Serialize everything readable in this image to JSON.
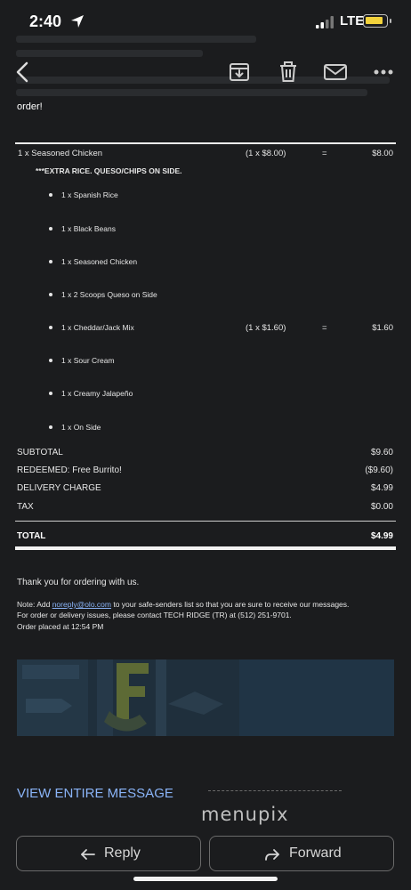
{
  "status_bar": {
    "time": "2:40",
    "carrier": "LTE"
  },
  "email": {
    "order_tail": "order!"
  },
  "order": {
    "main_item": {
      "name": "1 x Seasoned Chicken",
      "qty_price": "(1 x $8.00)",
      "eq": "=",
      "price": "$8.00"
    },
    "note": "***EXTRA RICE. QUESO/CHIPS ON SIDE.",
    "options": [
      {
        "text": "1 x Spanish Rice"
      },
      {
        "text": "1 x Black Beans"
      },
      {
        "text": "1 x Seasoned Chicken"
      },
      {
        "text": "1 x 2 Scoops Queso on Side"
      },
      {
        "text": "1 x Cheddar/Jack Mix",
        "qty_price": "(1 x $1.60)",
        "eq": "=",
        "price": "$1.60"
      },
      {
        "text": "1 x Sour Cream"
      },
      {
        "text": "1 x Creamy Jalapeño"
      },
      {
        "text": "1 x On Side"
      }
    ],
    "summary": [
      {
        "label": "SUBTOTAL",
        "value": "$9.60"
      },
      {
        "label": "REDEEMED: Free Burrito!",
        "value": "($9.60)"
      },
      {
        "label": "DELIVERY CHARGE",
        "value": "$4.99"
      },
      {
        "label": "TAX",
        "value": "$0.00"
      }
    ],
    "total": {
      "label": "TOTAL",
      "value": "$4.99"
    }
  },
  "footer": {
    "thanks": "Thank you for ordering with us.",
    "note_prefix": "Note: Add ",
    "note_link": "noreply@olo.com",
    "note_suffix": " to your safe-senders list so that you are sure to receive our messages.",
    "issues": "For order or delivery issues, please contact TECH RIDGE (TR) at (512) 251-9701.",
    "placed": "Order placed at 12:54 PM"
  },
  "view_entire": "VIEW ENTIRE MESSAGE",
  "watermark": "menupix",
  "actions": {
    "reply": "Reply",
    "forward": "Forward"
  },
  "colors": {
    "background": "#1b1c1e",
    "link": "#8ab4f8",
    "battery": "#f2d23c"
  }
}
